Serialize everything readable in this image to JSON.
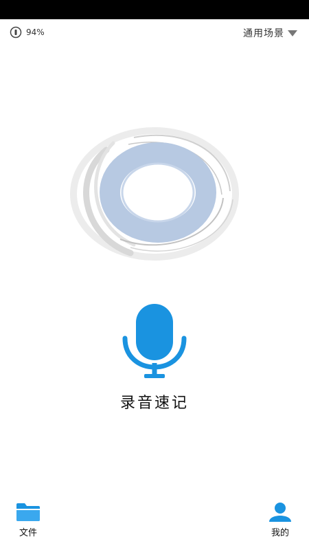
{
  "status": {
    "storage_percent": "94%"
  },
  "header": {
    "scene_label": "通用场景"
  },
  "main": {
    "record_title": "录音速记"
  },
  "nav": {
    "files_label": "文件",
    "mine_label": "我的"
  },
  "colors": {
    "accent": "#1a93e0",
    "wave_blue": "#b7c9e2",
    "wave_gray": "#d4d4d4"
  }
}
